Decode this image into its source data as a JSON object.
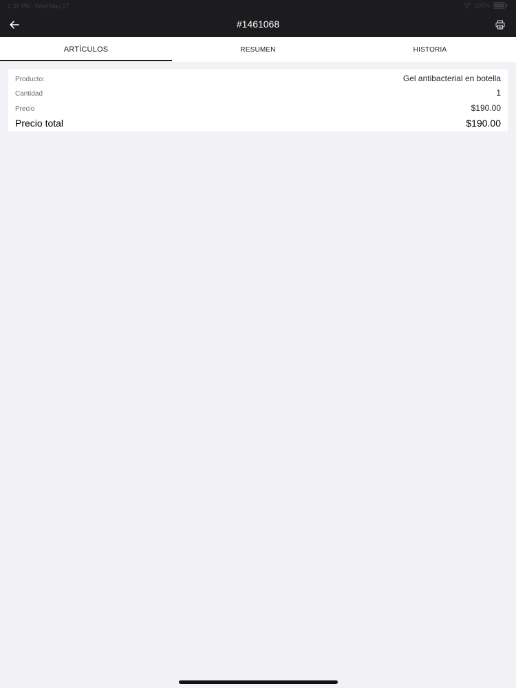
{
  "status_bar": {
    "time": "2:38 PM",
    "date": "Wed May 27",
    "battery": "100%"
  },
  "nav": {
    "back_icon": "arrow-left-icon",
    "title": "#1461068",
    "print_icon": "printer-icon"
  },
  "tabs": [
    {
      "label": "ARTÍCULOS",
      "active": true
    },
    {
      "label": "RESUMEN",
      "active": false
    },
    {
      "label": "HISTORIA",
      "active": false
    }
  ],
  "item": {
    "product_label": "Producto:",
    "product_value": "Gel antibacterial en botella",
    "quantity_label": "Cantidad",
    "quantity_value": "1",
    "price_label": "Precio",
    "price_value": "$190.00",
    "total_label": "Precio total",
    "total_value": "$190.00"
  },
  "colors": {
    "nav_background": "#1c1c1e",
    "page_background": "#f2f1f6",
    "card_background": "#ffffff"
  }
}
